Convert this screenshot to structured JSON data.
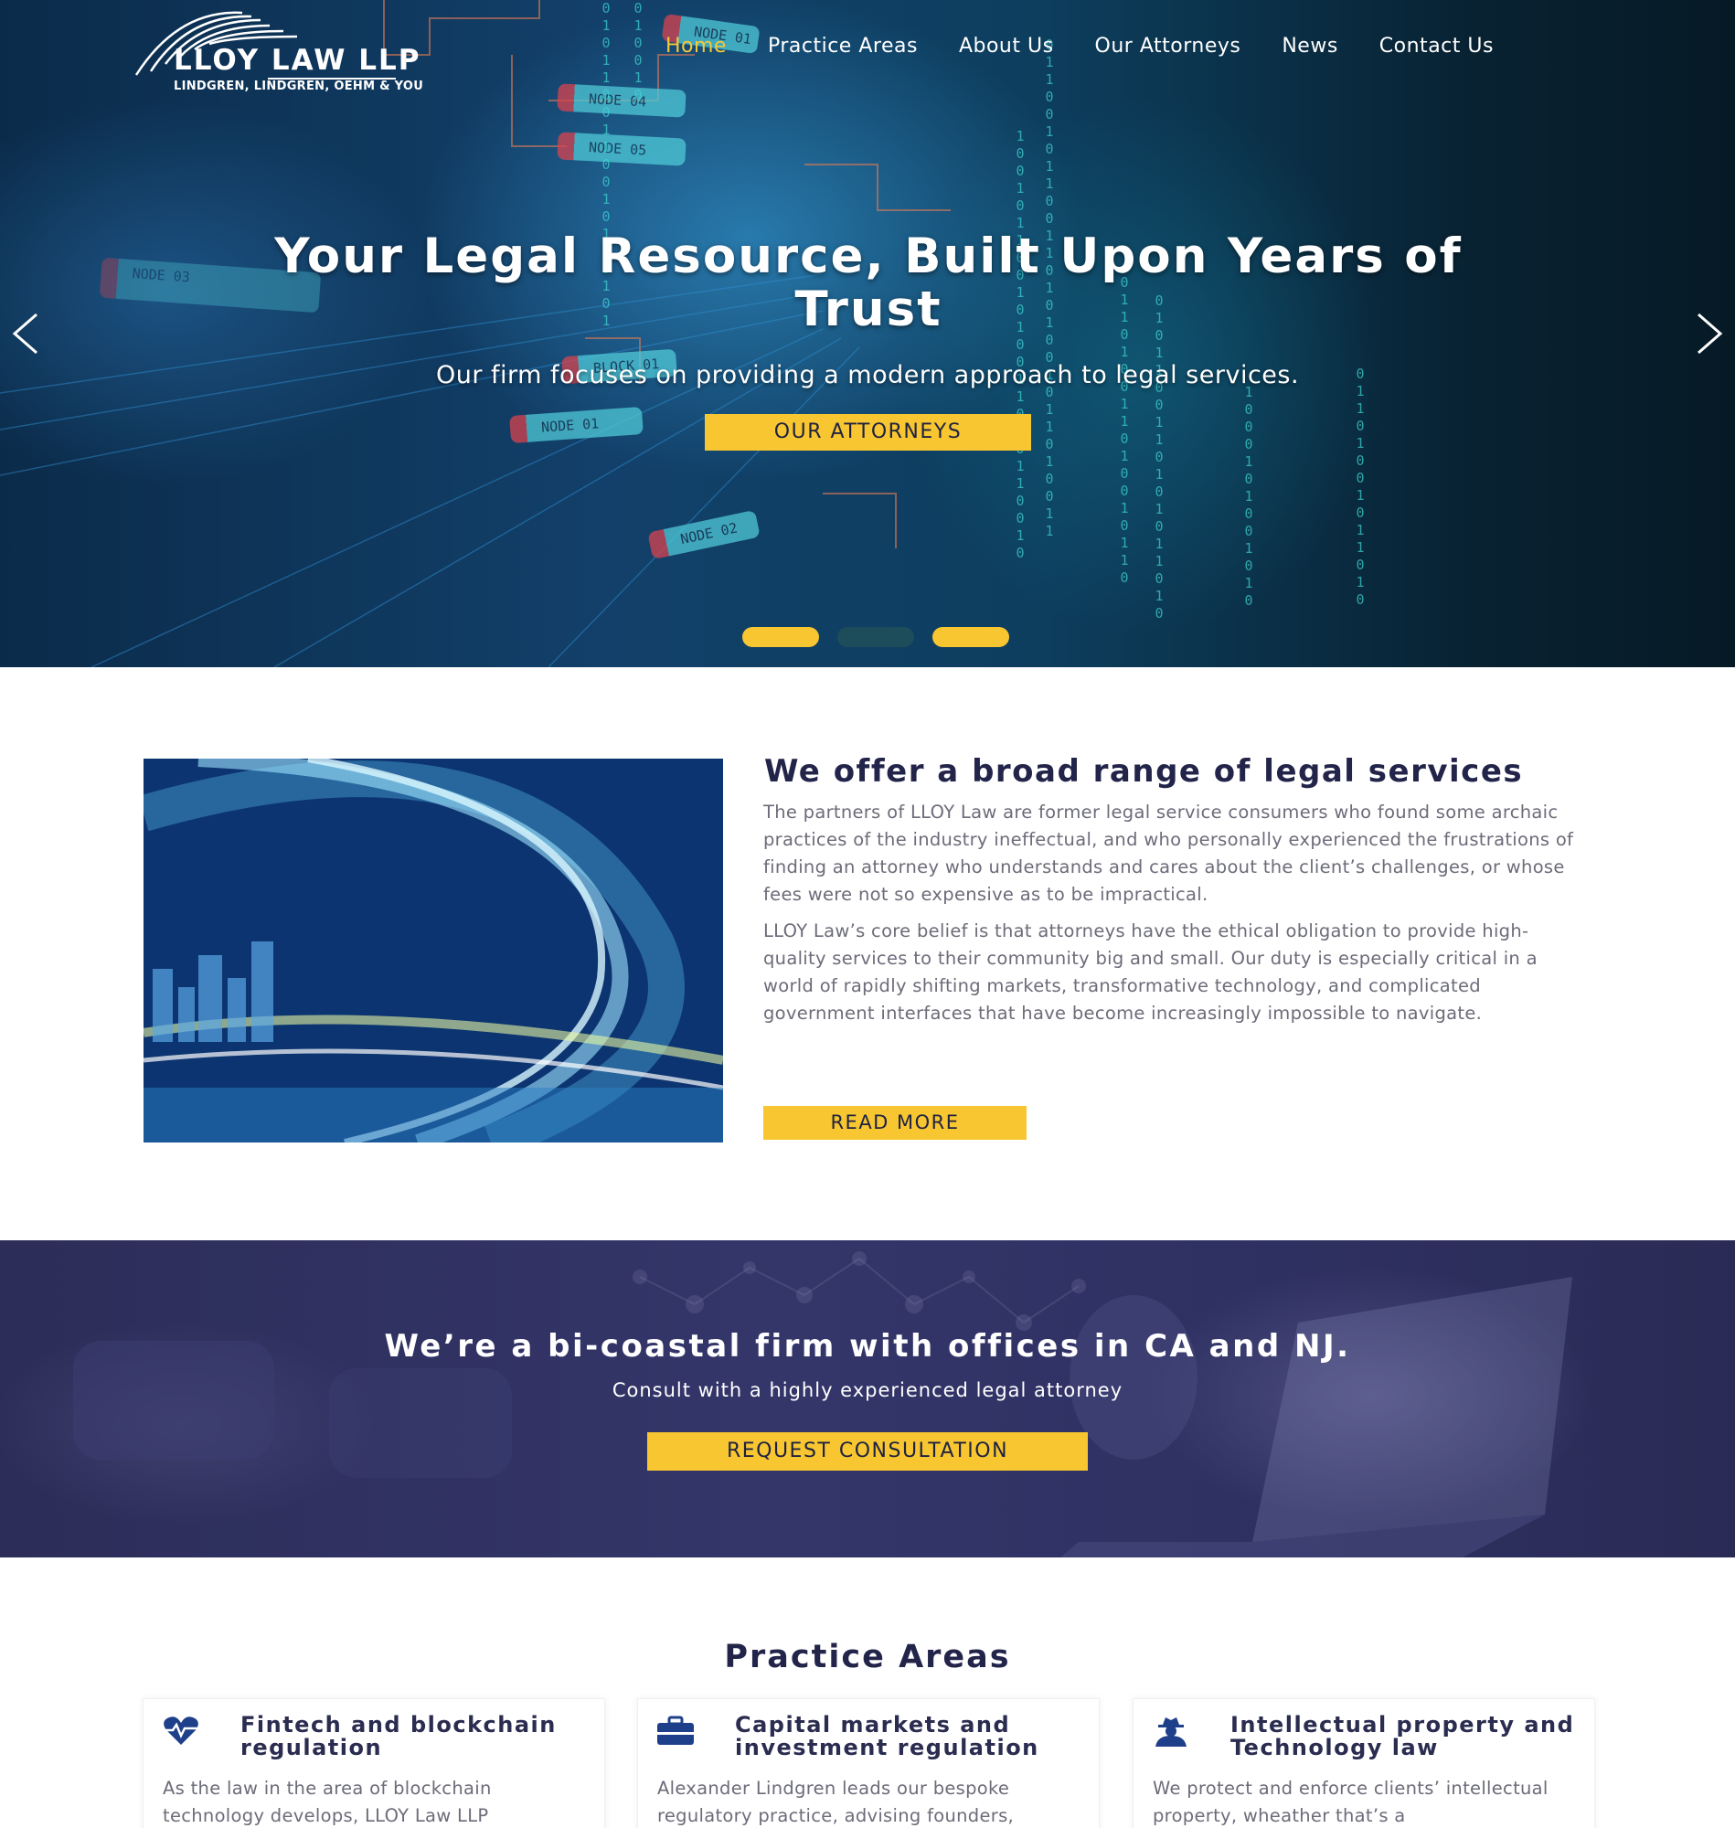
{
  "header": {
    "logo": {
      "name": "LLOY LAW LLP",
      "subtitle": "LINDGREN, LINDGREN, OEHM & YOU"
    },
    "nav": [
      {
        "label": "Home",
        "active": true
      },
      {
        "label": "Practice Areas",
        "active": false
      },
      {
        "label": "About Us",
        "active": false
      },
      {
        "label": "Our Attorneys",
        "active": false
      },
      {
        "label": "News",
        "active": false
      },
      {
        "label": "Contact Us",
        "active": false
      }
    ]
  },
  "hero": {
    "title": "Your Legal Resource, Built Upon Years of Trust",
    "subtitle": "Our firm focuses on providing a modern approach to legal services.",
    "button": "OUR ATTORNEYS",
    "prev_icon": "chevron-left-icon",
    "next_icon": "chevron-right-icon",
    "slides": 3,
    "active_slides": [
      0,
      2
    ],
    "background_labels": [
      "NODE 01",
      "NODE 04",
      "NODE 05",
      "BLOCK 01",
      "NODE 01",
      "NODE 02",
      "NODE 03"
    ]
  },
  "about": {
    "title": "We offer a broad range of legal services",
    "paragraph1": "The partners of LLOY Law are former legal service consumers who found some archaic practices of the industry ineffectual, and who personally experienced the frustrations of finding an attorney who understands and cares about the client’s challenges, or whose fees were not so expensive as to be impractical.",
    "paragraph2": "LLOY Law’s core belief is that attorneys have the ethical obligation to provide high-quality services to their community big and small. Our duty is especially critical in a world of rapidly shifting markets, transformative technology, and complicated government interfaces that have become increasingly impossible to navigate.",
    "button": "READ MORE"
  },
  "banner": {
    "title": "We’re a bi-coastal firm with offices in CA and NJ.",
    "subtitle": "Consult with a highly experienced legal attorney",
    "button": "REQUEST CONSULTATION"
  },
  "practice": {
    "title": "Practice Areas",
    "cards": [
      {
        "icon": "heartbeat-icon",
        "title": "Fintech and blockchain regulation",
        "text": "As the law in the area of blockchain technology develops, LLOY Law LLP"
      },
      {
        "icon": "briefcase-icon",
        "title": "Capital markets and investment regulation",
        "text": "Alexander Lindgren leads our bespoke regulatory practice, advising founders,"
      },
      {
        "icon": "user-secret-icon",
        "title": "Intellectual property and Technology law",
        "text": "We protect and enforce clients’ intellectual property, wheather that’s a"
      }
    ]
  },
  "colors": {
    "accent": "#f7c631",
    "active_nav": "#f4c93a",
    "heading": "#22244a",
    "body_text": "#6c6c7a",
    "banner_bg": "#2f3163",
    "icon": "#1e3f8a"
  }
}
